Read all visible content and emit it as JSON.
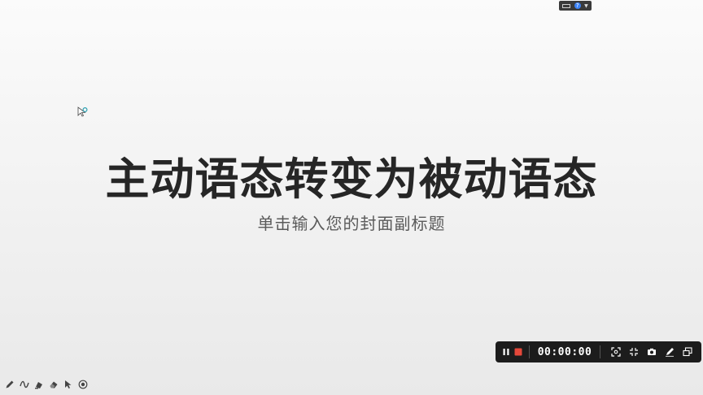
{
  "slide": {
    "title": "主动语态转变为被动语态",
    "subtitle": "单击输入您的封面副标题"
  },
  "recorder": {
    "timer": "00:00:00",
    "buttons": [
      "pause-icon",
      "stop-icon",
      "fullscreen-capture-icon",
      "minimize-icon",
      "camera-icon",
      "pen-icon",
      "window-icon"
    ],
    "stop_color": "#e5483a"
  },
  "mini_widget": {
    "help_label": "?"
  },
  "annotation_tools": [
    "pencil-icon",
    "curve-icon",
    "marker-icon",
    "eraser-icon",
    "pointer-icon",
    "record-dot-icon"
  ]
}
